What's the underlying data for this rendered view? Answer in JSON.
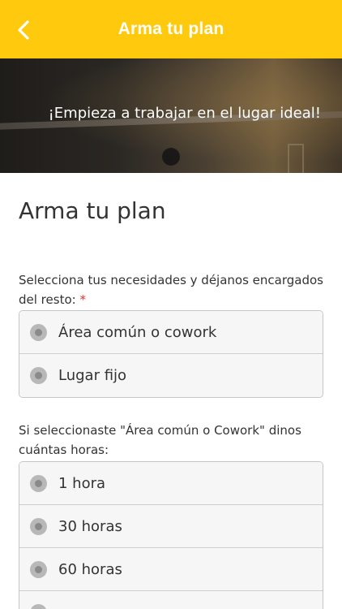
{
  "header": {
    "title": "Arma tu plan",
    "back_icon": "chevron-left-icon",
    "background_color": "#ffc90e"
  },
  "hero": {
    "text": "¡Empieza a trabajar en el lugar ideal!"
  },
  "main": {
    "title": "Arma tu plan",
    "question1": {
      "label": "Selecciona tus necesidades y déjanos encargados del resto:",
      "required_mark": "*",
      "options": [
        {
          "label": "Área común o cowork"
        },
        {
          "label": "Lugar fijo"
        }
      ]
    },
    "question2": {
      "label": "Si seleccionaste \"Área común o Cowork\" dinos cuántas horas:",
      "options": [
        {
          "label": "1 hora"
        },
        {
          "label": "30 horas"
        },
        {
          "label": "60 horas"
        },
        {
          "label": ""
        }
      ]
    }
  }
}
